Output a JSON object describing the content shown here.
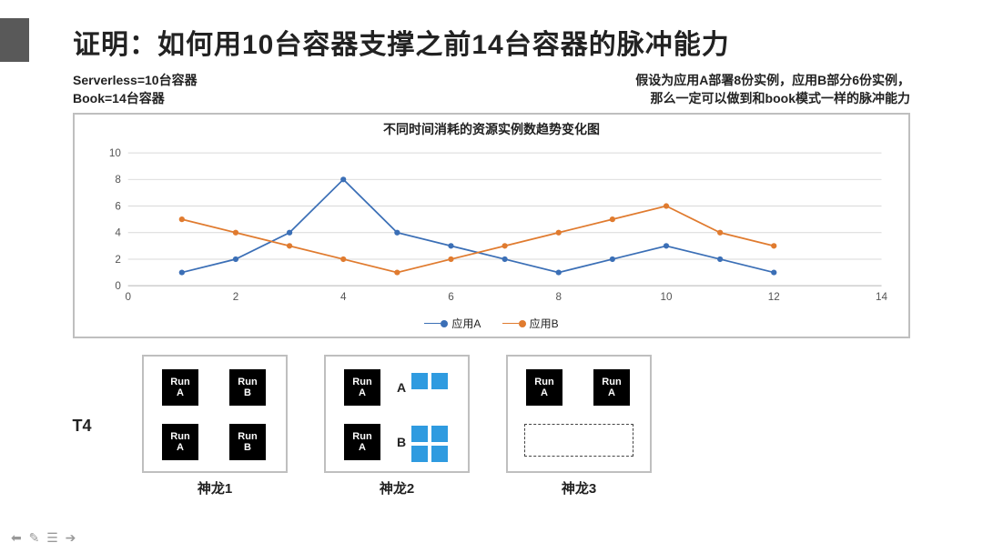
{
  "title": "证明：如何用10台容器支撑之前14台容器的脉冲能力",
  "sub_left": {
    "l1": "Serverless=10台容器",
    "l2": "Book=14台容器"
  },
  "sub_right": {
    "l1": "假设为应用A部署8份实例，应用B部分6份实例，",
    "l2": "那么一定可以做到和book模式一样的脉冲能力"
  },
  "t_label": "T4",
  "run_a": "Run\nA",
  "run_b": "Run\nB",
  "small_a": "A",
  "small_b": "B",
  "captions": {
    "c1": "神龙1",
    "c2": "神龙2",
    "c3": "神龙3"
  },
  "legend": {
    "a": "应用A",
    "b": "应用B"
  },
  "footer": "⬅ ✎ ☰ ➔",
  "chart_data": {
    "type": "line",
    "title": "不同时间消耗的资源实例数趋势变化图",
    "xlabel": "",
    "ylabel": "",
    "x_ticks": [
      0,
      2,
      4,
      6,
      8,
      10,
      12,
      14
    ],
    "y_ticks": [
      0,
      2,
      4,
      6,
      8,
      10
    ],
    "xlim": [
      0,
      14
    ],
    "ylim": [
      0,
      10
    ],
    "x": [
      1,
      2,
      3,
      4,
      5,
      6,
      7,
      8,
      9,
      10,
      11,
      12
    ],
    "series": [
      {
        "name": "应用A",
        "color": "#3b6fb6",
        "values": [
          1,
          2,
          4,
          8,
          4,
          3,
          2,
          1,
          2,
          3,
          2,
          1
        ]
      },
      {
        "name": "应用B",
        "color": "#e07b2f",
        "values": [
          5,
          4,
          3,
          2,
          1,
          2,
          3,
          4,
          5,
          6,
          4,
          3
        ]
      }
    ]
  }
}
